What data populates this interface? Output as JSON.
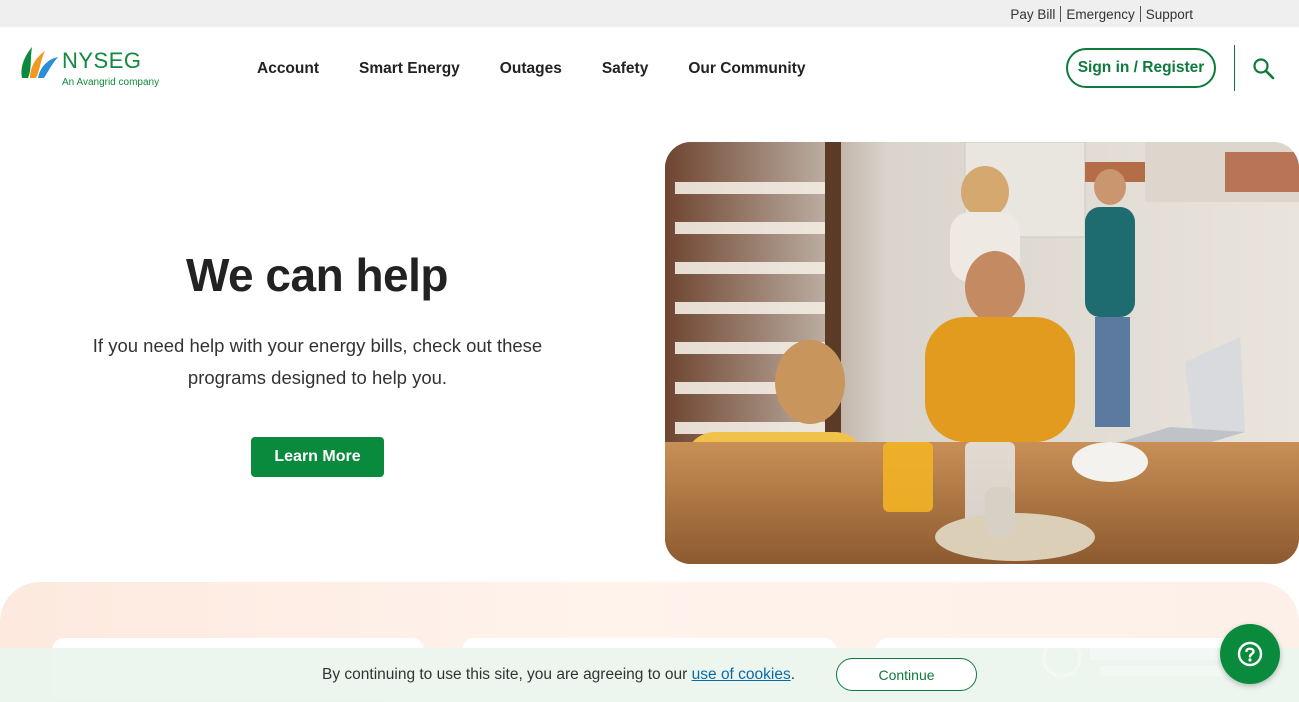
{
  "utility_nav": {
    "links": [
      "Pay Bill",
      "Emergency",
      "Support"
    ]
  },
  "header": {
    "logo_text": "NYSEG",
    "logo_subtext": "An Avangrid company",
    "nav_items": [
      "Account",
      "Smart Energy",
      "Outages",
      "Safety",
      "Our Community"
    ],
    "signin_label": "Sign in / Register",
    "search_icon": "search-icon"
  },
  "hero": {
    "title": "We can help",
    "body": "If you need help with your energy bills, check out these programs designed to help you.",
    "cta_label": "Learn More",
    "image_icon": "family-kitchen-photo"
  },
  "cookie_banner": {
    "text_before": "By continuing to use this site, you are agreeing to our ",
    "link_text": "use of cookies",
    "text_after": ".",
    "button_label": "Continue"
  },
  "help_button": {
    "icon": "help-chat-icon"
  },
  "colors": {
    "brand_green": "#0a8a3c",
    "brand_orange": "#f39a1e",
    "brand_blue": "#2a8fd6",
    "utility_bar_bg": "#efefef",
    "band_bg": "#fde9de",
    "cookie_bg": "#eaf5ee"
  }
}
